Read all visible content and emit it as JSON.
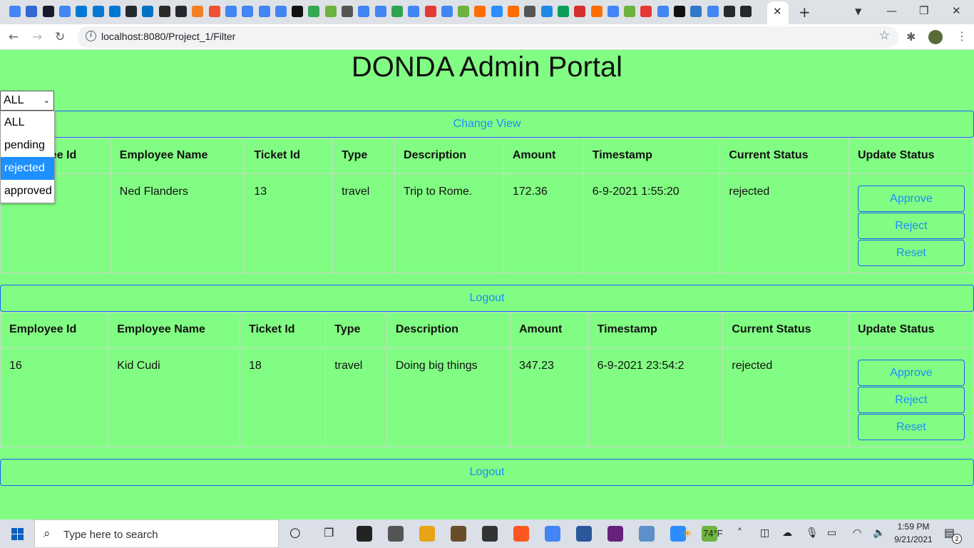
{
  "browser": {
    "tab_close_glyph": "✕",
    "new_tab_glyph": "+",
    "url": "localhost:8080/Project_1/Filter",
    "info_glyph": "i",
    "back_glyph": "←",
    "forward_glyph": "→",
    "reload_glyph": "↻",
    "star_glyph": "☆",
    "menu_glyph": "⋮",
    "minimize_glyph": "—",
    "restore_glyph": "❐",
    "close_glyph": "✕",
    "tab_icon_colors": [
      "#4285f4",
      "#3367d6",
      "#1a1a2e",
      "#4285f4",
      "#0078d4",
      "#0078d4",
      "#0078d4",
      "#24292e",
      "#0072c6",
      "#2b2b2b",
      "#24292e",
      "#f48024",
      "#f05133",
      "#4285f4",
      "#4285f4",
      "#4285f4",
      "#4285f4",
      "#111111",
      "#34a853",
      "#6db33f",
      "#555555",
      "#4285f4",
      "#4285f4",
      "#2ea44f",
      "#4285f4",
      "#e53935",
      "#4285f4",
      "#6db33f",
      "#ff6d00",
      "#2d8cff",
      "#ff6d00",
      "#555555",
      "#1e88e5",
      "#0f9d58",
      "#d32f2f",
      "#ff6d00",
      "#4285f4",
      "#6db33f",
      "#e53935",
      "#4285f4",
      "#111111",
      "#3178c6",
      "#4285f4",
      "#24292e",
      "#24292e"
    ]
  },
  "page": {
    "title": "DONDA Admin Portal",
    "filter": {
      "selected": "ALL",
      "options": [
        "ALL",
        "pending",
        "rejected",
        "approved"
      ],
      "highlighted_index": 2
    },
    "change_view_label": "Change View",
    "logout_label": "Logout",
    "table": {
      "headers": [
        "Employee Id",
        "Employee Name",
        "Ticket Id",
        "Type",
        "Description",
        "Amount",
        "Timestamp",
        "Current Status",
        "Update Status"
      ],
      "actions": [
        "Approve",
        "Reject",
        "Reset"
      ],
      "tickets": [
        {
          "employee_id": "",
          "employee_name": "Ned Flanders",
          "ticket_id": "13",
          "type": "travel",
          "description": "Trip to Rome.",
          "amount": "172.36",
          "timestamp": "6-9-2021 1:55:20",
          "status": "rejected"
        },
        {
          "employee_id": "16",
          "employee_name": "Kid Cudi",
          "ticket_id": "18",
          "type": "travel",
          "description": "Doing big things",
          "amount": "347.23",
          "timestamp": "6-9-2021 23:54:2",
          "status": "rejected"
        }
      ]
    }
  },
  "taskbar": {
    "search_placeholder": "Type here to search",
    "weather": "74°F",
    "time": "1:59 PM",
    "date": "9/21/2021",
    "notification_count": "2",
    "app_colors": [
      "#222222",
      "#555555",
      "#e8a317",
      "#6b4c2a",
      "#333333",
      "#ff5722",
      "#4285f4",
      "#2b579a",
      "#68217a",
      "#5d8fc9",
      "#2d8cff",
      "#6db33f"
    ]
  }
}
